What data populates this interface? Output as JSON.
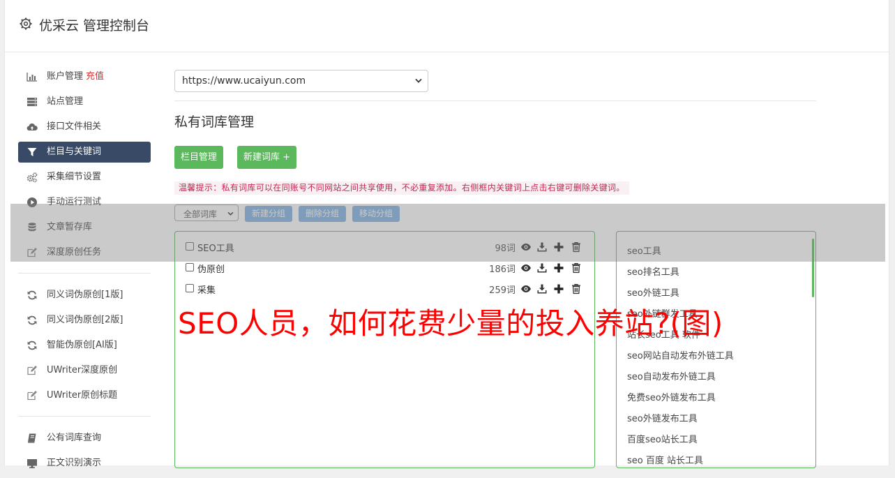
{
  "header": {
    "title": "优采云 管理控制台",
    "icon": "gear-icon"
  },
  "sidebar": {
    "group1": [
      {
        "label": "账户管理",
        "extra": "充值",
        "icon": "bar-chart-icon"
      },
      {
        "label": "站点管理",
        "icon": "server-icon"
      },
      {
        "label": "接口文件相关",
        "icon": "cloud-upload-icon"
      },
      {
        "label": "栏目与关键词",
        "icon": "filter-icon",
        "active": true
      },
      {
        "label": "采集细节设置",
        "icon": "gears-icon"
      },
      {
        "label": "手动运行测试",
        "icon": "play-circle-icon"
      },
      {
        "label": "文章暂存库",
        "icon": "database-icon"
      },
      {
        "label": "深度原创任务",
        "icon": "edit-icon"
      }
    ],
    "group2": [
      {
        "label": "同义词伪原创[1版]",
        "icon": "refresh-icon"
      },
      {
        "label": "同义词伪原创[2版]",
        "icon": "refresh-icon"
      },
      {
        "label": "智能伪原创[AI版]",
        "icon": "refresh-icon"
      },
      {
        "label": "UWriter深度原创",
        "icon": "edit-icon"
      },
      {
        "label": "UWriter原创标题",
        "icon": "edit-icon"
      }
    ],
    "group3": [
      {
        "label": "公有词库查询",
        "icon": "book-icon"
      },
      {
        "label": "正文识别演示",
        "icon": "monitor-icon"
      }
    ]
  },
  "main": {
    "site_select": "https://www.ucaiyun.com",
    "page_title": "私有词库管理",
    "btn_column": "栏目管理",
    "btn_new_lib": "新建词库 +",
    "tip": "温馨提示：私有词库可以在同账号不同网站之间共享使用，不必重复添加。右侧框内关键词上点击右键可删除关键词。",
    "group_select": "全部词库",
    "btn_new_group": "新建分组",
    "btn_delete_group": "删除分组",
    "btn_move_group": "移动分组",
    "libraries": [
      {
        "name": "SEO工具",
        "count": "98词"
      },
      {
        "name": "伪原创",
        "count": "186词"
      },
      {
        "name": "采集",
        "count": "259词"
      }
    ],
    "keywords": [
      "seo工具",
      "seo排名工具",
      "seo外链工具",
      "seo外链群发工具",
      "站长seo工具 软件",
      "seo网站自动发布外链工具",
      "seo自动发布外链工具",
      "免费seo外链发布工具",
      "seo外链发布工具",
      "百度seo站长工具",
      "seo 百度 站长工具"
    ]
  },
  "banner": "SEO人员，如何花费少量的投入养站?(图)",
  "colors": {
    "accent_green": "#5cb85c",
    "active_nav": "#384a66",
    "blue_button": "#7fb1e3",
    "banner_red": "#ff0000"
  }
}
